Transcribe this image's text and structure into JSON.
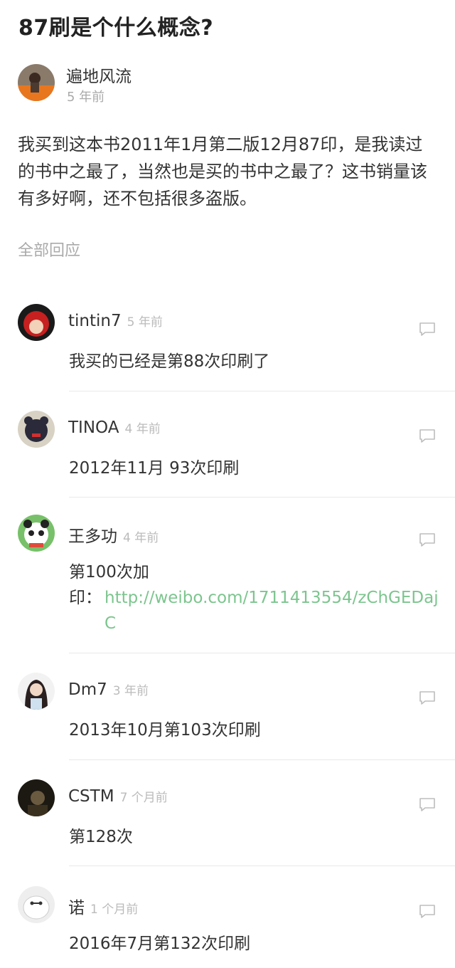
{
  "post": {
    "title": "87刷是个什么概念?",
    "author": "遍地风流",
    "time": "5 年前",
    "body": "我买到这本书2011年1月第二版12月87印，是我读过的书中之最了，当然也是买的书中之最了？这书销量该有多好啊，还不包括很多盗版。"
  },
  "section_label": "全部回应",
  "comments": [
    {
      "user": "tintin7",
      "time": "5 年前",
      "text": "我买的已经是第88次印刷了"
    },
    {
      "user": "TINOA",
      "time": "4 年前",
      "text": "2012年11月 93次印刷"
    },
    {
      "user": "王多功",
      "time": "4 年前",
      "text": "第100次加印：",
      "link": "http://weibo.com/1711413554/zChGEDajC"
    },
    {
      "user": "Dm7",
      "time": "3 年前",
      "text": "2013年10月第103次印刷"
    },
    {
      "user": "CSTM",
      "time": "7 个月前",
      "text": "第128次"
    },
    {
      "user": "诺",
      "time": "1 个月前",
      "text": "2016年7月第132次印刷"
    }
  ],
  "icons": {
    "reply": "comment-bubble-icon",
    "link_color": "#7cc58e"
  }
}
